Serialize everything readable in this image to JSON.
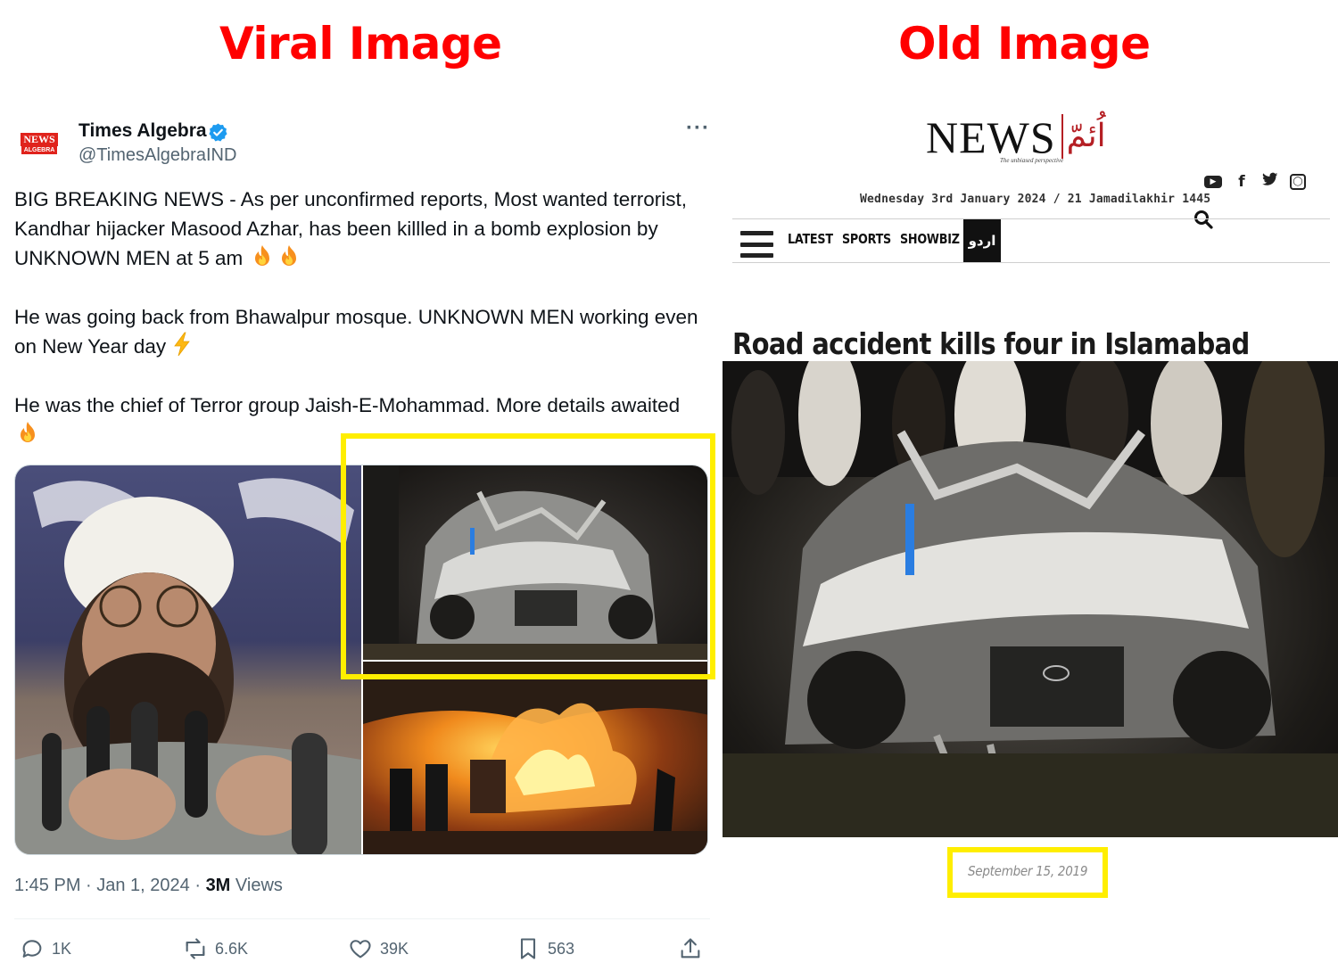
{
  "headings": {
    "left": "Viral Image",
    "right": "Old Image"
  },
  "tweet": {
    "avatar": {
      "line1": "NEWS",
      "line2": "ALGEBRA"
    },
    "author_name": "Times Algebra",
    "author_handle": "@TimesAlgebraIND",
    "paragraphs": [
      "BIG BREAKING NEWS - As per unconfirmed reports, Most wanted terrorist, Kandhar hijacker Masood Azhar, has been killled in a bomb explosion by UNKNOWN MEN at 5 am",
      "He was going back from Bhawalpur mosque. UNKNOWN MEN working even on New Year day",
      "He was the chief of Terror group Jaish-E-Mohammad. More details awaited"
    ],
    "meta": {
      "time_date": "1:45 PM · Jan 1, 2024 · ",
      "views_count": "3M",
      "views_label": " Views"
    },
    "actions": {
      "replies": "1K",
      "reposts": "6.6K",
      "likes": "39K",
      "bookmarks": "563"
    }
  },
  "news_site": {
    "logo_text": "NEWS",
    "logo_urdu": "اُئمّ",
    "tagline": "The unbiased perspective",
    "dateline": "Wednesday 3rd January 2024 / 21 Jamadilakhir 1445",
    "nav": {
      "latest": "LATEST",
      "sports": "SPORTS",
      "showbiz": "SHOWBIZ",
      "urdu": "اردو"
    },
    "article_title": "Road accident kills four in Islamabad",
    "article_date": "September 15, 2019"
  },
  "colors": {
    "heading": "#ff0000",
    "highlight": "#ffee00",
    "verified": "#1d9bf0",
    "muted": "#536471"
  },
  "icons": [
    "verified-badge-icon",
    "more-options-icon",
    "reply-icon",
    "repost-icon",
    "like-icon",
    "bookmark-icon",
    "share-icon",
    "youtube-icon",
    "facebook-icon",
    "twitter-icon",
    "instagram-icon",
    "search-icon",
    "menu-icon"
  ]
}
